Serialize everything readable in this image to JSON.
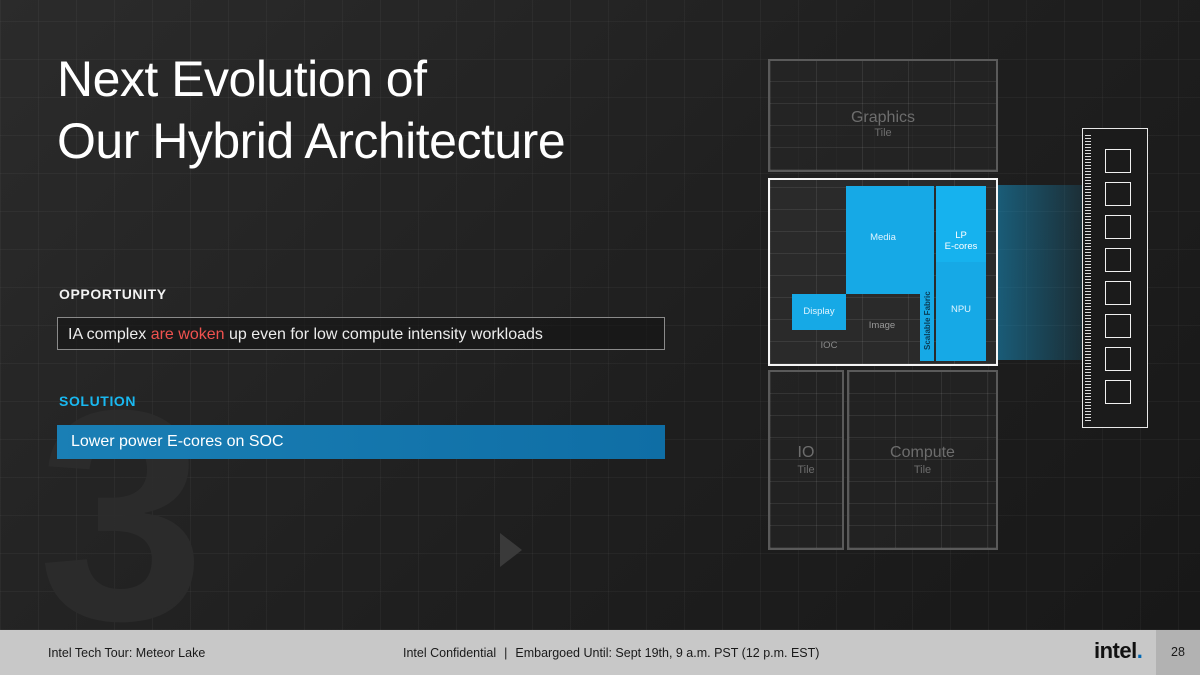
{
  "background_numeral": "3",
  "title": {
    "line1": "Next Evolution of",
    "line2": "Our Hybrid Architecture"
  },
  "opportunity": {
    "label": "OPPORTUNITY",
    "text_before": "IA complex ",
    "text_highlight": "are woken",
    "text_after": " up even for low compute intensity workloads"
  },
  "solution": {
    "label": "SOLUTION",
    "text": "Lower power E-cores on SOC"
  },
  "diagram": {
    "graphics": {
      "name": "Graphics",
      "sub": "Tile"
    },
    "io": {
      "name": "IO",
      "sub": "Tile"
    },
    "compute": {
      "name": "Compute",
      "sub": "Tile"
    },
    "soc": {
      "media": "Media",
      "lp_line1": "LP",
      "lp_line2": "E-cores",
      "npu": "NPU",
      "display": "Display",
      "image": "Image",
      "ioc": "IOC",
      "fabric": "Scalable Fabric"
    }
  },
  "footer": {
    "left": "Intel Tech Tour: Meteor Lake",
    "confidential": "Intel Confidential",
    "separator": "|",
    "embargo": "Embargoed Until: Sept 19th, 9 a.m. PST (12 p.m. EST)",
    "logo": "intel",
    "logo_dot": ".",
    "page": "28"
  },
  "colors": {
    "accent_blue": "#16a9e6",
    "highlight_red": "#f0524f",
    "solution_label": "#19b8f0"
  }
}
